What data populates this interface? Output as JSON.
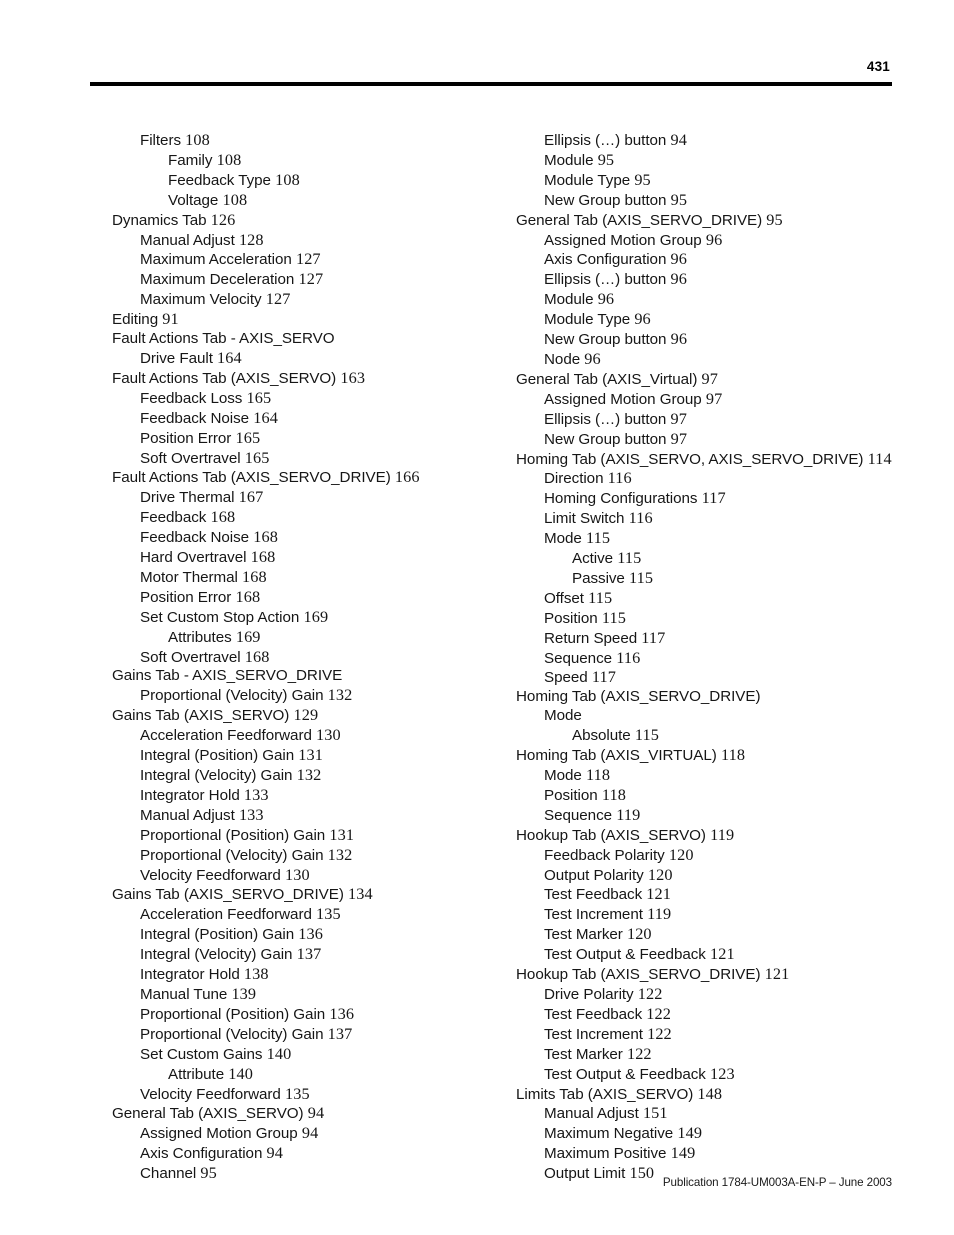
{
  "header": {
    "folio": "431"
  },
  "footer": {
    "publication": "Publication 1784-UM003A-EN-P – June 2003"
  },
  "index": {
    "left_column": [
      {
        "level": 1,
        "label": "Filters",
        "page": "108"
      },
      {
        "level": 2,
        "label": "Family",
        "page": "108"
      },
      {
        "level": 2,
        "label": "Feedback Type",
        "page": "108"
      },
      {
        "level": 2,
        "label": "Voltage",
        "page": "108"
      },
      {
        "level": 0,
        "label": "Dynamics Tab",
        "page": "126"
      },
      {
        "level": 1,
        "label": "Manual Adjust",
        "page": "128"
      },
      {
        "level": 1,
        "label": "Maximum Acceleration",
        "page": "127"
      },
      {
        "level": 1,
        "label": "Maximum Deceleration",
        "page": "127"
      },
      {
        "level": 1,
        "label": "Maximum Velocity",
        "page": "127"
      },
      {
        "level": 0,
        "label": "Editing",
        "page": "91"
      },
      {
        "level": 0,
        "label": "Fault Actions Tab - AXIS_SERVO",
        "page": ""
      },
      {
        "level": 1,
        "label": "Drive Fault",
        "page": "164"
      },
      {
        "level": 0,
        "label": "Fault Actions Tab (AXIS_SERVO)",
        "page": "163"
      },
      {
        "level": 1,
        "label": "Feedback Loss",
        "page": "165"
      },
      {
        "level": 1,
        "label": "Feedback Noise",
        "page": "164"
      },
      {
        "level": 1,
        "label": "Position Error",
        "page": "165"
      },
      {
        "level": 1,
        "label": "Soft Overtravel",
        "page": "165"
      },
      {
        "level": 0,
        "label": "Fault Actions Tab (AXIS_SERVO_DRIVE)",
        "page": "166"
      },
      {
        "level": 1,
        "label": "Drive Thermal",
        "page": "167"
      },
      {
        "level": 1,
        "label": "Feedback",
        "page": "168"
      },
      {
        "level": 1,
        "label": "Feedback Noise",
        "page": "168"
      },
      {
        "level": 1,
        "label": "Hard Overtravel",
        "page": "168"
      },
      {
        "level": 1,
        "label": "Motor Thermal",
        "page": "168"
      },
      {
        "level": 1,
        "label": "Position Error",
        "page": "168"
      },
      {
        "level": 1,
        "label": "Set Custom Stop Action",
        "page": "169"
      },
      {
        "level": 2,
        "label": "Attributes",
        "page": "169"
      },
      {
        "level": 1,
        "label": "Soft Overtravel",
        "page": "168"
      },
      {
        "level": 0,
        "label": "Gains Tab - AXIS_SERVO_DRIVE",
        "page": ""
      },
      {
        "level": 1,
        "label": "Proportional (Velocity) Gain",
        "page": "132"
      },
      {
        "level": 0,
        "label": "Gains Tab (AXIS_SERVO)",
        "page": "129"
      },
      {
        "level": 1,
        "label": "Acceleration Feedforward",
        "page": "130"
      },
      {
        "level": 1,
        "label": "Integral (Position) Gain",
        "page": "131"
      },
      {
        "level": 1,
        "label": "Integral (Velocity) Gain",
        "page": "132"
      },
      {
        "level": 1,
        "label": "Integrator Hold",
        "page": "133"
      },
      {
        "level": 1,
        "label": "Manual Adjust",
        "page": "133"
      },
      {
        "level": 1,
        "label": "Proportional (Position) Gain",
        "page": "131"
      },
      {
        "level": 1,
        "label": "Proportional (Velocity) Gain",
        "page": "132"
      },
      {
        "level": 1,
        "label": "Velocity Feedforward",
        "page": "130"
      },
      {
        "level": 0,
        "label": "Gains Tab (AXIS_SERVO_DRIVE)",
        "page": "134"
      },
      {
        "level": 1,
        "label": "Acceleration Feedforward",
        "page": "135"
      },
      {
        "level": 1,
        "label": "Integral (Position) Gain",
        "page": "136"
      },
      {
        "level": 1,
        "label": "Integral (Velocity) Gain",
        "page": "137"
      },
      {
        "level": 1,
        "label": "Integrator Hold",
        "page": "138"
      },
      {
        "level": 1,
        "label": "Manual Tune",
        "page": "139"
      },
      {
        "level": 1,
        "label": "Proportional (Position) Gain",
        "page": "136"
      },
      {
        "level": 1,
        "label": "Proportional (Velocity) Gain",
        "page": "137"
      },
      {
        "level": 1,
        "label": "Set Custom Gains",
        "page": "140"
      },
      {
        "level": 2,
        "label": "Attribute",
        "page": "140"
      },
      {
        "level": 1,
        "label": "Velocity Feedforward",
        "page": "135"
      },
      {
        "level": 0,
        "label": "General Tab (AXIS_SERVO)",
        "page": "94"
      },
      {
        "level": 1,
        "label": "Assigned Motion Group",
        "page": "94"
      },
      {
        "level": 1,
        "label": "Axis Configuration",
        "page": "94"
      },
      {
        "level": 1,
        "label": "Channel",
        "page": "95"
      }
    ],
    "right_column": [
      {
        "level": 1,
        "label": "Ellipsis (…) button",
        "page": "94"
      },
      {
        "level": 1,
        "label": "Module",
        "page": "95"
      },
      {
        "level": 1,
        "label": "Module Type",
        "page": "95"
      },
      {
        "level": 1,
        "label": "New Group button",
        "page": "95"
      },
      {
        "level": 0,
        "label": "General Tab (AXIS_SERVO_DRIVE)",
        "page": "95"
      },
      {
        "level": 1,
        "label": "Assigned Motion Group",
        "page": "96"
      },
      {
        "level": 1,
        "label": "Axis Configuration",
        "page": "96"
      },
      {
        "level": 1,
        "label": "Ellipsis (…) button",
        "page": "96"
      },
      {
        "level": 1,
        "label": "Module",
        "page": "96"
      },
      {
        "level": 1,
        "label": "Module Type",
        "page": "96"
      },
      {
        "level": 1,
        "label": "New Group button",
        "page": "96"
      },
      {
        "level": 1,
        "label": "Node",
        "page": "96"
      },
      {
        "level": 0,
        "label": "General Tab (AXIS_Virtual)",
        "page": "97"
      },
      {
        "level": 1,
        "label": "Assigned Motion Group",
        "page": "97"
      },
      {
        "level": 1,
        "label": "Ellipsis (…) button",
        "page": "97"
      },
      {
        "level": 1,
        "label": "New Group button",
        "page": "97"
      },
      {
        "level": 0,
        "label": "Homing Tab (AXIS_SERVO, AXIS_SERVO_DRIVE)",
        "page": "114"
      },
      {
        "level": 1,
        "label": "Direction",
        "page": "116"
      },
      {
        "level": 1,
        "label": "Homing Configurations",
        "page": "117"
      },
      {
        "level": 1,
        "label": "Limit Switch",
        "page": "116"
      },
      {
        "level": 1,
        "label": "Mode",
        "page": "115"
      },
      {
        "level": 2,
        "label": "Active",
        "page": "115"
      },
      {
        "level": 2,
        "label": "Passive",
        "page": "115"
      },
      {
        "level": 1,
        "label": "Offset",
        "page": "115"
      },
      {
        "level": 1,
        "label": "Position",
        "page": "115"
      },
      {
        "level": 1,
        "label": "Return Speed",
        "page": "117"
      },
      {
        "level": 1,
        "label": "Sequence",
        "page": "116"
      },
      {
        "level": 1,
        "label": "Speed",
        "page": "117"
      },
      {
        "level": 0,
        "label": "Homing Tab (AXIS_SERVO_DRIVE)",
        "page": ""
      },
      {
        "level": 1,
        "label": "Mode",
        "page": ""
      },
      {
        "level": 2,
        "label": "Absolute",
        "page": "115"
      },
      {
        "level": 0,
        "label": "Homing Tab (AXIS_VIRTUAL)",
        "page": "118"
      },
      {
        "level": 1,
        "label": "Mode",
        "page": "118"
      },
      {
        "level": 1,
        "label": "Position",
        "page": "118"
      },
      {
        "level": 1,
        "label": "Sequence",
        "page": "119"
      },
      {
        "level": 0,
        "label": "Hookup Tab (AXIS_SERVO)",
        "page": "119"
      },
      {
        "level": 1,
        "label": "Feedback Polarity",
        "page": "120"
      },
      {
        "level": 1,
        "label": "Output Polarity",
        "page": "120"
      },
      {
        "level": 1,
        "label": "Test Feedback",
        "page": "121"
      },
      {
        "level": 1,
        "label": "Test Increment",
        "page": "119"
      },
      {
        "level": 1,
        "label": "Test Marker",
        "page": "120"
      },
      {
        "level": 1,
        "label": "Test Output & Feedback",
        "page": "121"
      },
      {
        "level": 0,
        "label": "Hookup Tab (AXIS_SERVO_DRIVE)",
        "page": "121"
      },
      {
        "level": 1,
        "label": "Drive Polarity",
        "page": "122"
      },
      {
        "level": 1,
        "label": "Test Feedback",
        "page": "122"
      },
      {
        "level": 1,
        "label": "Test Increment",
        "page": "122"
      },
      {
        "level": 1,
        "label": "Test Marker",
        "page": "122"
      },
      {
        "level": 1,
        "label": "Test Output & Feedback",
        "page": "123"
      },
      {
        "level": 0,
        "label": "Limits Tab (AXIS_SERVO)",
        "page": "148"
      },
      {
        "level": 1,
        "label": "Manual Adjust",
        "page": "151"
      },
      {
        "level": 1,
        "label": "Maximum Negative",
        "page": "149"
      },
      {
        "level": 1,
        "label": "Maximum Positive",
        "page": "149"
      },
      {
        "level": 1,
        "label": "Output Limit",
        "page": "150"
      }
    ]
  }
}
